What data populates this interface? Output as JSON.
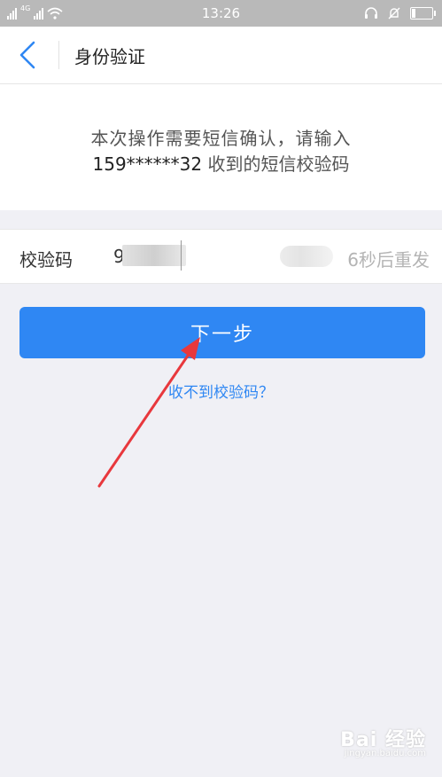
{
  "status_bar": {
    "carrier_left": "4G",
    "time": "13:26",
    "icons": [
      "signal-icon",
      "signal-icon",
      "wifi-icon",
      "headset-icon",
      "alarm-off-icon",
      "battery-icon"
    ],
    "battery_level": 0.2
  },
  "nav": {
    "back_icon": "chevron-left-icon",
    "title": "身份验证"
  },
  "notice": {
    "line1": "本次操作需要短信确认，请输入",
    "phone_masked": "159******32",
    "line2_suffix": " 收到的短信校验码"
  },
  "code_field": {
    "label": "校验码",
    "value": "9",
    "resend_text": "6秒后重发"
  },
  "actions": {
    "next_label": "下一步",
    "help_link": "收不到校验码？"
  },
  "watermark": {
    "brand": "Bai 经验",
    "sub": "jingyan.baidu.com"
  },
  "colors": {
    "accent": "#2f87f3",
    "status_bar": "#b9b9b9",
    "arrow": "#e8383d",
    "background": "#f0f0f5"
  }
}
